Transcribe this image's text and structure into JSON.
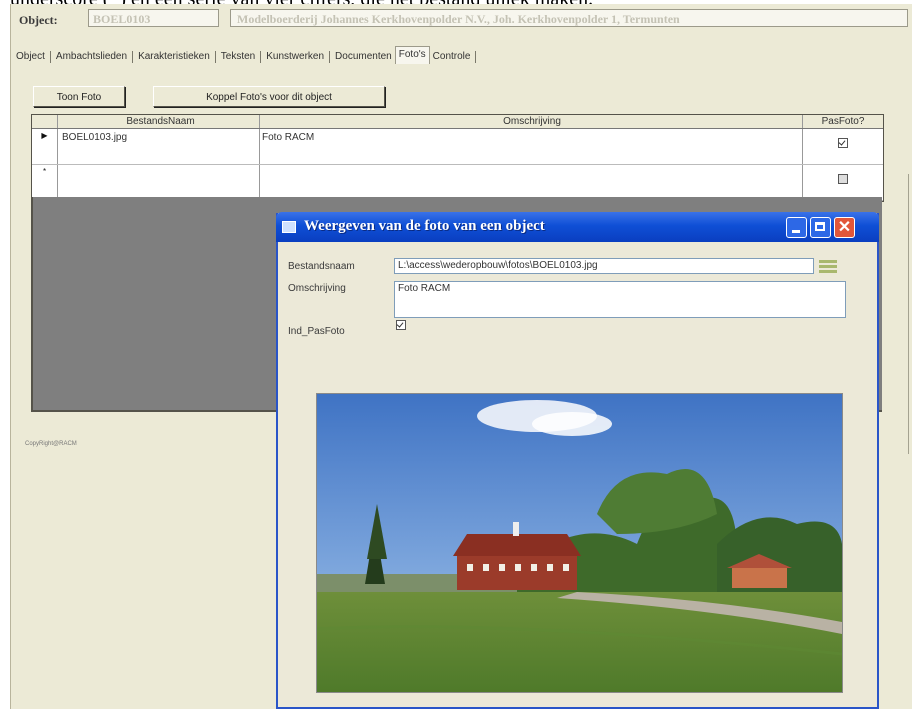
{
  "caption_top": "underscore (_) en een serie van vier cijfers, die het bestand uniek maken.",
  "object": {
    "label": "Object:",
    "code": "BOEL0103",
    "name": "Modelboerderij Johannes Kerkhovenpolder N.V., Joh. Kerkhovenpolder 1, Termunten"
  },
  "tabs": [
    {
      "label": "Object",
      "active": false
    },
    {
      "label": "Ambachtslieden",
      "active": false
    },
    {
      "label": "Karakteristieken",
      "active": false
    },
    {
      "label": "Teksten",
      "active": false
    },
    {
      "label": "Kunstwerken",
      "active": false
    },
    {
      "label": "Documenten",
      "active": false
    },
    {
      "label": "Foto's",
      "active": true
    },
    {
      "label": "Controle",
      "active": false
    }
  ],
  "buttons": {
    "toon_foto": "Toon Foto",
    "koppel_fotos": "Koppel Foto's voor dit object"
  },
  "grid": {
    "columns": [
      "BestandsNaam",
      "Omschrijving",
      "PasFoto?"
    ],
    "rows": [
      {
        "marker": "▶",
        "bestandsnaam": "BOEL0103.jpg",
        "omschrijving": "Foto RACM",
        "pasfoto": true
      },
      {
        "marker": "*",
        "bestandsnaam": "",
        "omschrijving": "",
        "pasfoto": false
      }
    ]
  },
  "copyright": "CopyRight@RACM",
  "dialog": {
    "title": "Weergeven van de foto van een object",
    "labels": {
      "bestandsnaam": "Bestandsnaam",
      "omschrijving": "Omschrijving",
      "ind_pasfoto": "Ind_PasFoto"
    },
    "bestandsnaam_value": "L:\\access\\wederopbouw\\fotos\\BOEL0103.jpg",
    "omschrijving_value": "Foto RACM",
    "ind_pasfoto": true
  },
  "colors": {
    "form_bg": "#ecead6",
    "titlebar": "#0f4fd6",
    "close_button": "#e2563a",
    "dark_area": "#7f7f7f"
  }
}
